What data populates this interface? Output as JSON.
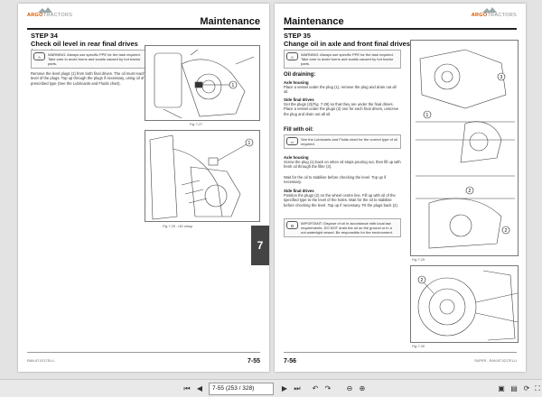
{
  "left_page": {
    "brand": "ARGO",
    "brand_sub": "TRACTORS",
    "header": "Maintenance",
    "step": "STEP 34",
    "title": "Check oil level in rear final drives (C.038)",
    "warning": "WARNING: Always use specific PPE for the task required. Take care to avoid burns and scalds caused by hot tractor parts.",
    "body": "Remove the level plugs (1) from both final drives. The oil must reach the level of the plugs. Top up through the plugs if necessary, using oil of the prescribed type (See the Lubricants and Fluids chart).",
    "fig1_caption": "Fig.7-27",
    "fig2_caption": "Fig.7-28 - HD setup",
    "fig_label": "1",
    "footer_left": "RAN.6T.0217ELLI",
    "page_number": "7-55",
    "section_tab": "7"
  },
  "right_page": {
    "header": "Maintenance",
    "step": "STEP 35",
    "title": "Change oil in axle and front final drives (S.001)",
    "warning": "WARNING: Always use specific PPE for the task required. Take care to avoid burns and scalds caused by hot tractor parts.",
    "oil_draining": "Oil draining:",
    "axle_housing": "Axle housing",
    "axle_text": "Place a vessel under the plug (1), remove the plug and drain out all oil.",
    "side_final_drives": "Side final drives",
    "side_text": "Get the plugs (2)(Fig. 7-29) so that they are under the final drives. Place a vessel under the plugs (2) one for each final drives, unscrew the plug and drain out all oil.",
    "fill_with_oil": "Fill with oil:",
    "fill_note": "See the Lubricants and Fluids chart for the correct type of oil required.",
    "axle_housing_2": "Axle housing",
    "axle_fill": "Screw the plug (1) back on when oil stops pouring out, then fill up with fresh oil through the filler (3).",
    "axle_wait": "Wait for the oil to stabilise before checking the level. Top up if necessary.",
    "side_final_drives_2": "Side final drives",
    "side_fill": "Position the plugs (2) on the wheel centre line. Fill up with oil of the specified type to the level of the holes. Wait for the oil to stabilise before checking the level. Top up if necessary. Fit the plugs back (2).",
    "important": "IMPORTANT: Dispose of oil in accordance with local law requirements. DO NOT drain the oil on the ground or in a not watertight vessel. Be responsible for the environment.",
    "fig1_caption": "Fig.7-29",
    "fig2_caption": "Fig.7-30",
    "footer_right": "SUPER - RAN.6T.0217ELLI",
    "page_number": "7-56",
    "labels": [
      "1",
      "3",
      "2",
      "2"
    ]
  },
  "toolbar": {
    "page_field": "7-55 (253 / 328)",
    "icons": [
      "first-page-icon",
      "prev-page-icon",
      "next-page-icon",
      "last-page-icon",
      "back-icon",
      "forward-icon",
      "zoom-out-icon",
      "zoom-in-icon",
      "fit-page-icon",
      "fit-width-icon",
      "rotate-icon",
      "fullscreen-icon"
    ]
  }
}
